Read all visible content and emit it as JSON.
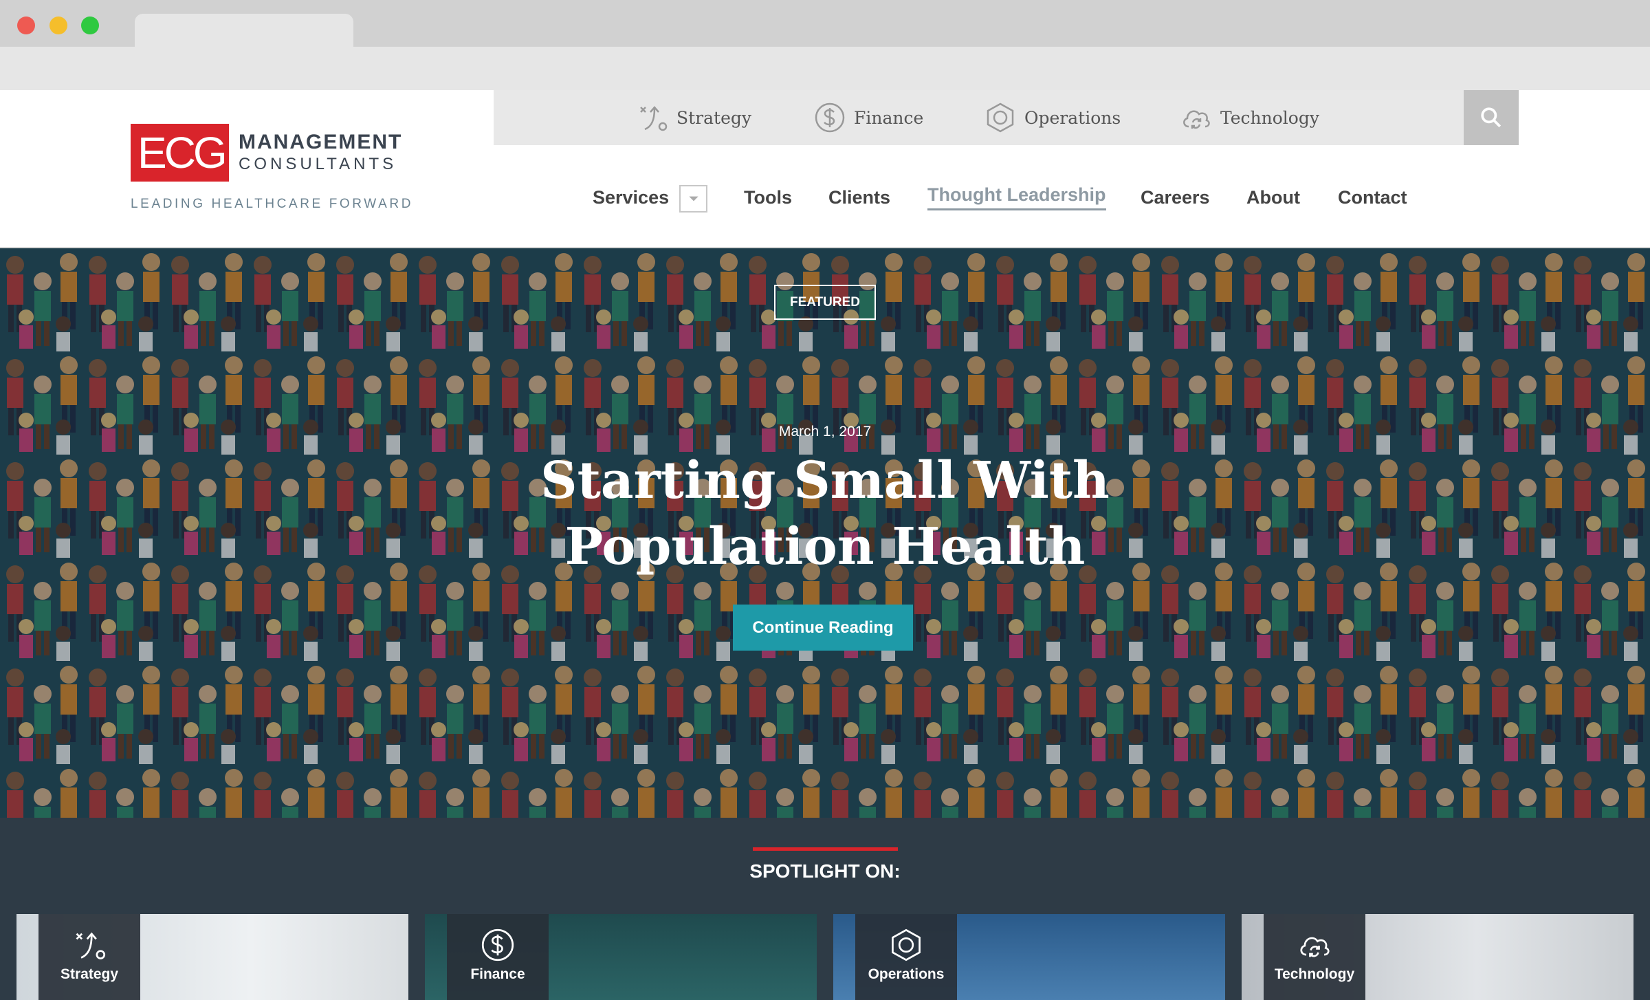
{
  "browser": {
    "colors": {
      "close": "#ee5a52",
      "minimize": "#f5be2b",
      "maximize": "#2fc940"
    }
  },
  "logo": {
    "mark": "ECG",
    "line1": "MANAGEMENT",
    "line2": "CONSULTANTS",
    "tagline": "LEADING HEALTHCARE FORWARD"
  },
  "utility_nav": [
    {
      "label": "Strategy",
      "icon": "strategy-icon"
    },
    {
      "label": "Finance",
      "icon": "dollar-icon"
    },
    {
      "label": "Operations",
      "icon": "hexagon-icon"
    },
    {
      "label": "Technology",
      "icon": "cloud-icon"
    }
  ],
  "search": {
    "icon": "search-icon"
  },
  "main_nav": {
    "services": "Services",
    "tools": "Tools",
    "clients": "Clients",
    "thought_leadership": "Thought Leadership",
    "careers": "Careers",
    "about": "About",
    "contact": "Contact",
    "active": "Thought Leadership"
  },
  "hero": {
    "badge": "FEATURED",
    "date": "March 1, 2017",
    "title": "Starting Small With Population Health",
    "cta": "Continue Reading"
  },
  "spotlight": {
    "heading_strong": "SPOTLIGHT",
    "heading_rest": " ON:",
    "cards": [
      {
        "label": "Strategy",
        "icon": "strategy-icon"
      },
      {
        "label": "Finance",
        "icon": "dollar-icon"
      },
      {
        "label": "Operations",
        "icon": "hexagon-icon"
      },
      {
        "label": "Technology",
        "icon": "cloud-icon"
      }
    ]
  },
  "colors": {
    "brand_red": "#d9242b",
    "cta_teal": "#1e9aa8",
    "spotlight_bg": "#2e3b46"
  }
}
